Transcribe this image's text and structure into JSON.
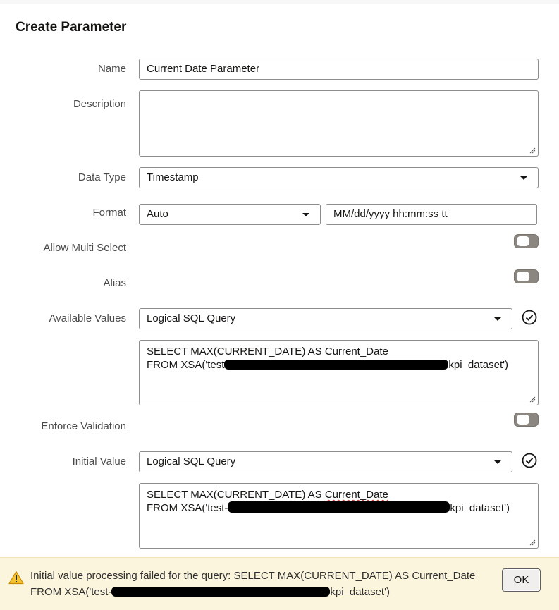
{
  "dialog": {
    "title": "Create Parameter"
  },
  "labels": {
    "name": "Name",
    "description": "Description",
    "data_type": "Data Type",
    "format": "Format",
    "allow_multi_select": "Allow Multi Select",
    "alias": "Alias",
    "available_values": "Available Values",
    "enforce_validation": "Enforce Validation",
    "initial_value": "Initial Value"
  },
  "fields": {
    "name_value": "Current Date Parameter",
    "description_value": "",
    "data_type_selected": "Timestamp",
    "format_selected": "Auto",
    "format_pattern": "MM/dd/yyyy hh:mm:ss tt",
    "available_values_selected": "Logical SQL Query",
    "available_sql": {
      "line1": "SELECT MAX(CURRENT_DATE) AS Current_Date",
      "line2_prefix": "FROM XSA('test",
      "line2_suffix": "kpi_dataset')"
    },
    "initial_value_selected": "Logical SQL Query",
    "initial_sql": {
      "line1_a": "SELECT MAX(CURRENT_DATE) AS ",
      "line1_b": "Current_Date",
      "line2_prefix": "FROM XSA('test-",
      "line2_suffix": "kpi_dataset')"
    }
  },
  "toggles": {
    "allow_multi_select": false,
    "alias": false,
    "enforce_validation": false
  },
  "banner": {
    "line1": "Initial value processing failed for the query: SELECT MAX(CURRENT_DATE) AS Current_Date",
    "line2_prefix": "FROM XSA('test-",
    "line2_suffix": "kpi_dataset')",
    "ok_label": "OK"
  },
  "icons": {
    "select_caret": "caret-down-icon",
    "validate": "check-circle-icon",
    "warning": "warning-icon",
    "resize": "resize-handle-icon"
  },
  "colors": {
    "toggle_off": "#8b8680",
    "banner_bg": "#fcf5dd",
    "warning": "#e8a20c"
  }
}
